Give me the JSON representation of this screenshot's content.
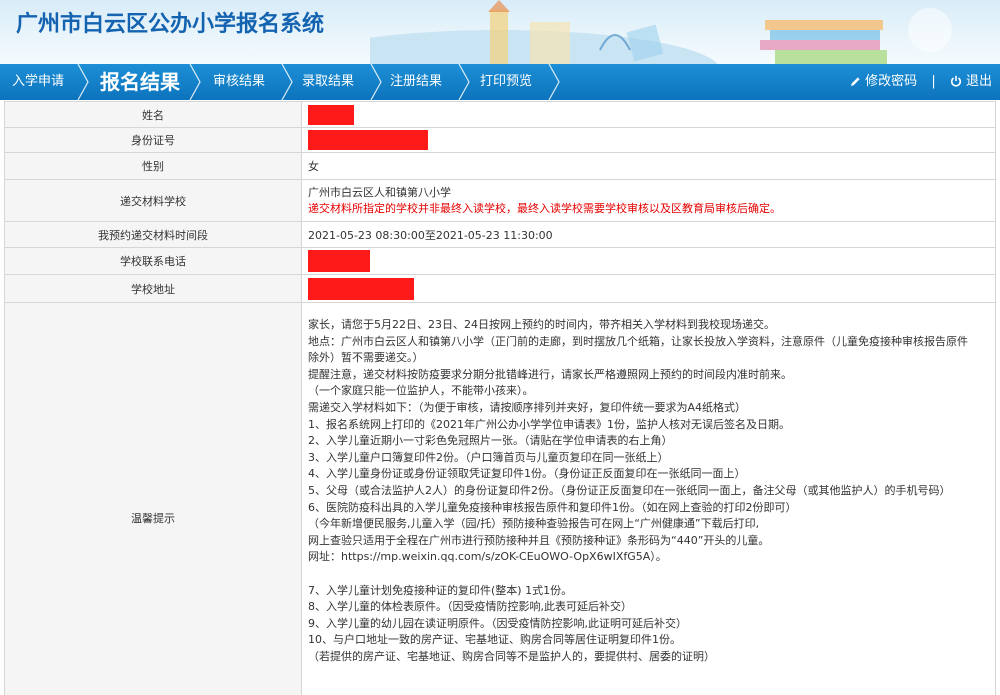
{
  "app": {
    "title": "广州市白云区公办小学报名系统"
  },
  "nav": {
    "items": [
      {
        "label": "入学申请",
        "active": false
      },
      {
        "label": "报名结果",
        "active": true
      },
      {
        "label": "审核结果",
        "active": false
      },
      {
        "label": "录取结果",
        "active": false
      },
      {
        "label": "注册结果",
        "active": false
      },
      {
        "label": "打印预览",
        "active": false
      }
    ],
    "change_password": "修改密码",
    "divider": "|",
    "logout": "退出"
  },
  "table": {
    "rows": {
      "name": {
        "label": "姓名"
      },
      "id_number": {
        "label": "身份证号"
      },
      "gender": {
        "label": "性别",
        "value": "女"
      },
      "school": {
        "label": "递交材料学校",
        "value": "广州市白云区人和镇第八小学",
        "warning": "递交材料所指定的学校并非最终入读学校，最终入读学校需要学校审核以及区教育局审核后确定。"
      },
      "time_slot": {
        "label": "我预约递交材料时间段",
        "value": "2021-05-23 08:30:00至2021-05-23 11:30:00"
      },
      "phone": {
        "label": "学校联系电话"
      },
      "address": {
        "label": "学校地址"
      },
      "tips": {
        "label": "温馨提示",
        "lines": [
          "家长，请您于5月22日、23日、24日按网上预约的时间内，带齐相关入学材料到我校现场递交。",
          "    地点：广州市白云区人和镇第八小学（正门前的走廊，到时摆放几个纸箱，让家长投放入学资料，注意原件（儿童免疫接种审核报告原件",
          "除外）暂不需要递交。）",
          "    提醒注意，递交材料按防疫要求分期分批错峰进行，请家长严格遵照网上预约的时间段内准时前来。",
          "            （一个家庭只能一位监护人，不能带小孩来）。",
          "需递交入学材料如下：（为便于审核，请按顺序排列并夹好，复印件统一要求为A4纸格式）",
          "1、报名系统网上打印的《2021年广州公办小学学位申请表》1份，监护人核对无误后签名及日期。",
          "2、入学儿童近期小一寸彩色免冠照片一张。（请贴在学位申请表的右上角）",
          "3、入学儿童户口簿复印件2份。（户口簿首页与儿童页复印在同一张纸上）",
          "4、入学儿童身份证或身份证领取凭证复印件1份。（身份证正反面复印在一张纸同一面上）",
          "5、父母（或合法监护人2人）的身份证复印件2份。（身份证正反面复印在一张纸同一面上，备注父母（或其他监护人）的手机号码）",
          "6、医院防疫科出具的入学儿童免疫接种审核报告原件和复印件1份。（如在网上查验的打印2份即可）",
          "  （今年新增便民服务,儿童入学（园/托）预防接种查验报告可在网上“广州健康通”下载后打印,",
          "    网上查验只适用于全程在广州市进行预防接种并且《预防接种证》条形码为“440”开头的儿童。",
          "    网址：https://mp.weixin.qq.com/s/zOK-CEuOWO-OpX6wIXfG5A）。",
          "",
          "7、入学儿童计划免疫接种证的复印件(整本) 1式1份。",
          "8、入学儿童的体检表原件。（因受疫情防控影响,此表可延后补交）",
          "9、入学儿童的幼儿园在读证明原件。（因受疫情防控影响,此证明可延后补交）",
          "10、与户口地址一致的房产证、宅基地证、购房合同等居住证明复印件1份。",
          "    （若提供的房产证、宅基地证、购房合同等不是监护人的，要提供村、居委的证明）"
        ]
      }
    }
  },
  "colors": {
    "nav_bg": "#0c73bc",
    "title": "#1463b0",
    "redaction": "#ff1a1a",
    "warning": "#e60000"
  },
  "icons": [
    "pencil-icon",
    "power-icon"
  ]
}
